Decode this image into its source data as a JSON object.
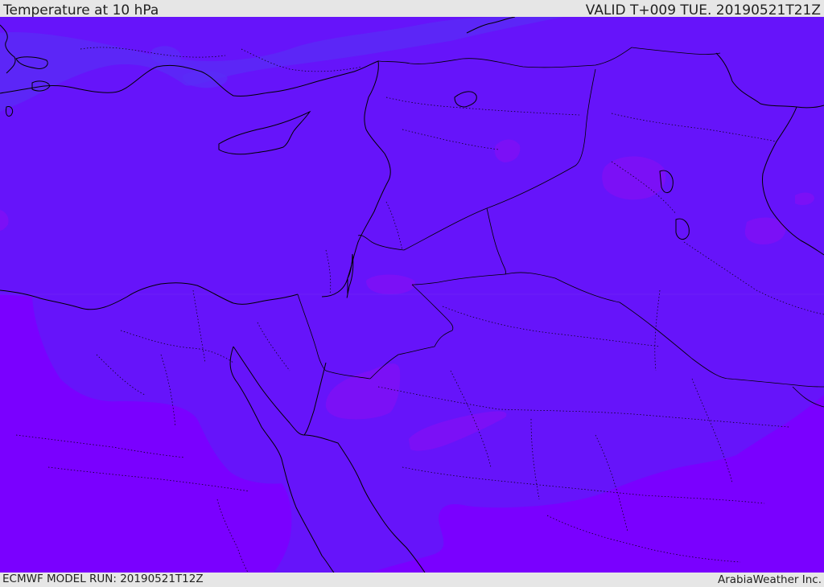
{
  "header": {
    "title": "Temperature at 10 hPa",
    "valid": "VALID T+009 TUE. 20190521T21Z"
  },
  "footer": {
    "model_run": "ECMWF MODEL RUN: 20190521T12Z",
    "credit": "ArabiaWeather Inc."
  },
  "colors": {
    "field_base": "#6614fa",
    "field_warm": "#7a00ff",
    "field_cool": "#5a2cf6",
    "patch_warm": "#7b10f6",
    "coastline": "#000000",
    "header_bg": "#e6e6e6"
  }
}
